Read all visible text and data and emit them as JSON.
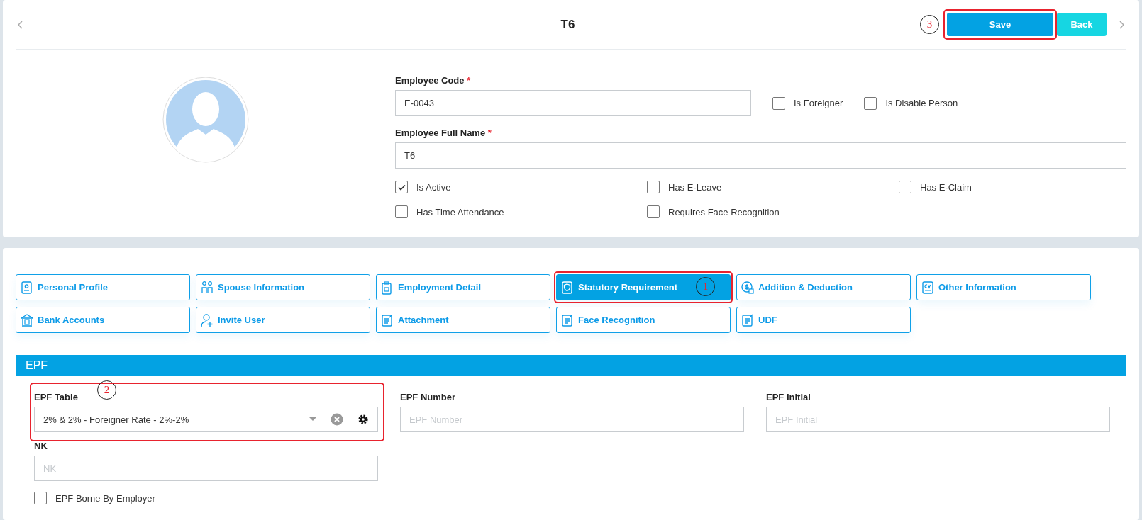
{
  "header": {
    "title": "T6",
    "save": {
      "label": "Save",
      "callout": "3"
    },
    "back": {
      "label": "Back"
    }
  },
  "profile": {
    "code_label": "Employee Code",
    "code_required_mark": "*",
    "code_value": "E-0043",
    "name_label": "Employee Full Name",
    "name_required_mark": "*",
    "name_value": "T6",
    "side_checks": [
      {
        "label": "Is Foreigner",
        "checked": false
      },
      {
        "label": "Is Disable Person",
        "checked": false
      }
    ],
    "checks": [
      {
        "label": "Is Active",
        "checked": true
      },
      {
        "label": "Has E-Leave",
        "checked": false
      },
      {
        "label": "Has E-Claim",
        "checked": false
      },
      {
        "label": "Has Time Attendance",
        "checked": false
      },
      {
        "label": "Requires Face Recognition",
        "checked": false
      }
    ]
  },
  "tabs": [
    {
      "label": "Personal Profile",
      "selected": false
    },
    {
      "label": "Spouse Information",
      "selected": false
    },
    {
      "label": "Employment Detail",
      "selected": false
    },
    {
      "label": "Statutory Requirement",
      "selected": true,
      "callout": "1"
    },
    {
      "label": "Addition & Deduction",
      "selected": false
    },
    {
      "label": "Other Information",
      "selected": false
    },
    {
      "label": "Bank Accounts",
      "selected": false
    },
    {
      "label": "Invite User",
      "selected": false
    },
    {
      "label": "Attachment",
      "selected": false
    },
    {
      "label": "Face Recognition",
      "selected": false
    },
    {
      "label": "UDF",
      "selected": false
    }
  ],
  "section": {
    "title": "EPF",
    "fields": [
      {
        "kind": "select",
        "label": "EPF Table",
        "value": "2% & 2% - Foreigner Rate - 2%-2%",
        "callout": "2"
      },
      {
        "kind": "text",
        "label": "EPF Number",
        "placeholder": "EPF Number"
      },
      {
        "kind": "text",
        "label": "EPF Initial",
        "placeholder": "EPF Initial"
      },
      {
        "kind": "text",
        "label": "NK",
        "placeholder": "NK"
      }
    ],
    "checks": [
      {
        "label": "EPF Borne By Employer",
        "checked": false
      }
    ]
  }
}
